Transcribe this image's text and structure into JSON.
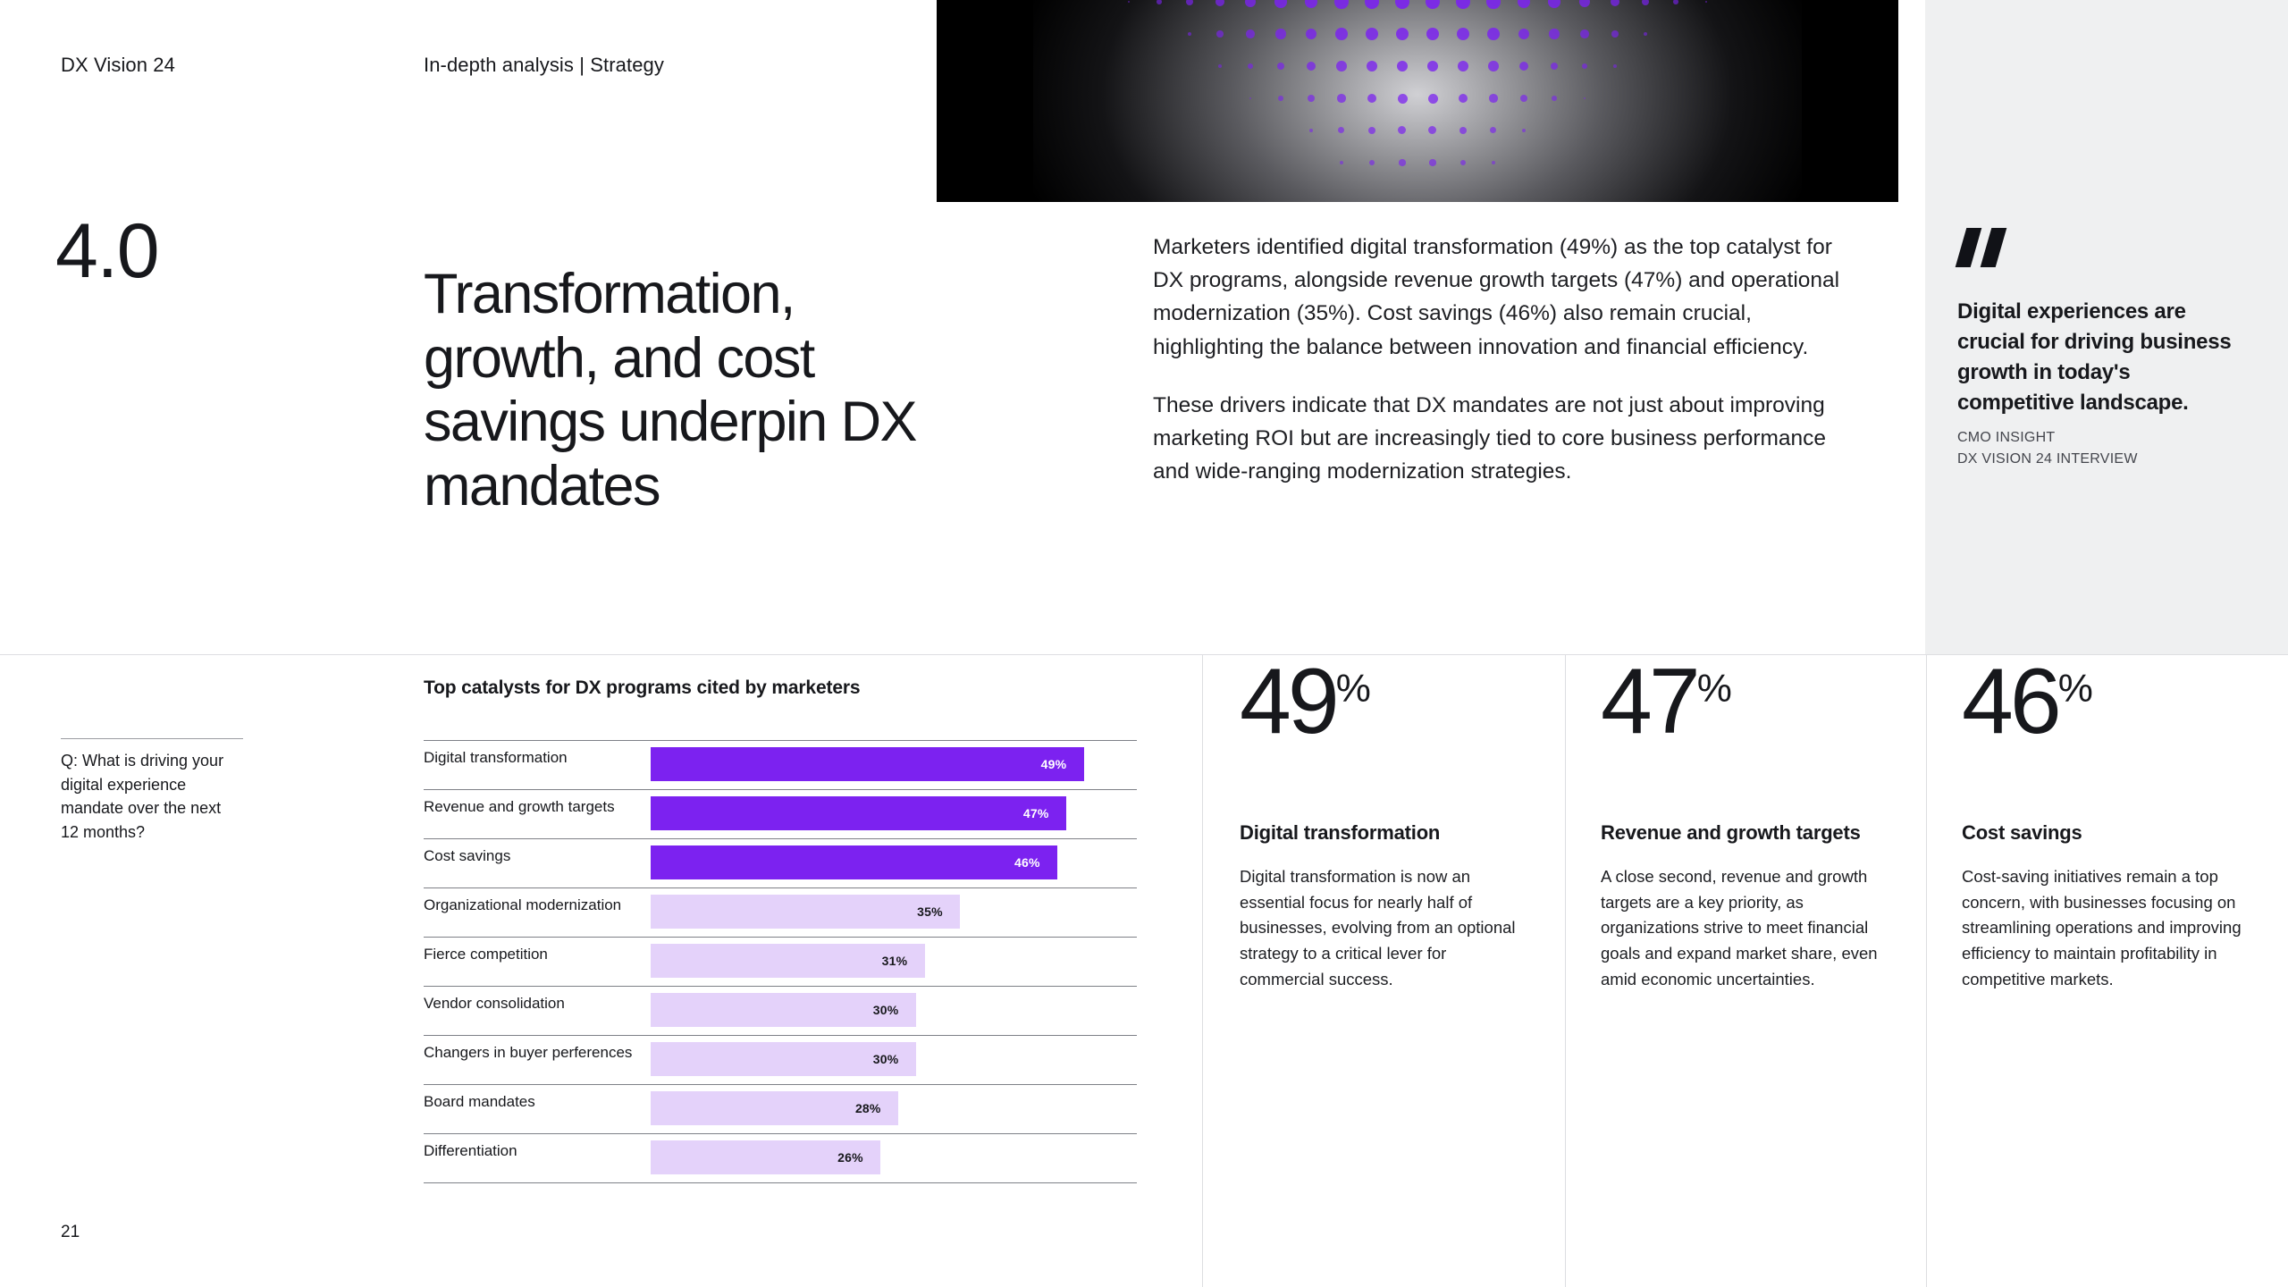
{
  "meta": {
    "brand": "DX Vision 24",
    "section": "In-depth analysis | Strategy",
    "page_number": "21"
  },
  "hero": {
    "background_color": "#000000",
    "dot_color": "#7b22f0",
    "glow_color": "#e2e2e6",
    "pattern": "halftone-dome"
  },
  "headline": {
    "chapter_number": "4.0",
    "title": "Transformation, growth, and cost savings underpin DX mandates"
  },
  "body": {
    "paragraphs": [
      "Marketers identified digital transformation (49%) as the top catalyst for DX programs, alongside revenue growth targets (47%) and operational modernization (35%). Cost savings (46%) also remain crucial, highlighting the balance between innovation and financial efficiency.",
      "These drivers indicate that DX mandates are not just about improving marketing ROI but are increasingly tied to core business performance and wide-ranging modernization strategies."
    ]
  },
  "quote": {
    "text": "Digital experiences are crucial for driving business growth in today's competitive landscape.",
    "attribution_line_1": "CMO INSIGHT",
    "attribution_line_2": "DX VISION 24 INTERVIEW",
    "panel_color": "#eff0f1"
  },
  "question": {
    "text": "Q: What is driving your digital experience mandate over the next 12 months?"
  },
  "chart_data": {
    "type": "bar",
    "title": "Top catalysts for DX programs cited by marketers",
    "xlabel": "",
    "ylabel": "",
    "xlim": [
      0,
      55
    ],
    "grid": false,
    "legend": "none",
    "orientation": "horizontal",
    "value_suffix": "%",
    "highlight_color": "#7c22f0",
    "muted_color": "#e4d2fa",
    "categories": [
      "Digital transformation",
      "Revenue and growth targets",
      "Cost savings",
      "Organizational modernization",
      "Fierce competition",
      "Vendor consolidation",
      "Changers in buyer perferences",
      "Board mandates",
      "Differentiation"
    ],
    "values": [
      49,
      47,
      46,
      35,
      31,
      30,
      30,
      28,
      26
    ],
    "labels": [
      "49%",
      "47%",
      "46%",
      "35%",
      "31%",
      "30%",
      "30%",
      "28%",
      "26%"
    ],
    "highlighted": [
      true,
      true,
      true,
      false,
      false,
      false,
      false,
      false,
      false
    ]
  },
  "stats": [
    {
      "value": "49",
      "unit": "%",
      "heading": "Digital transformation",
      "body": "Digital transformation is now an essential focus for nearly half of businesses, evolving from an optional strategy to a critical lever for commercial success."
    },
    {
      "value": "47",
      "unit": "%",
      "heading": "Revenue and growth targets",
      "body": "A close second, revenue and growth targets are a key priority, as organizations strive to meet financial goals and expand market share, even amid economic uncertainties."
    },
    {
      "value": "46",
      "unit": "%",
      "heading": "Cost savings",
      "body": "Cost-saving initiatives remain a top concern, with businesses focusing on streamlining operations and improving efficiency to maintain profitability in competitive markets."
    }
  ]
}
